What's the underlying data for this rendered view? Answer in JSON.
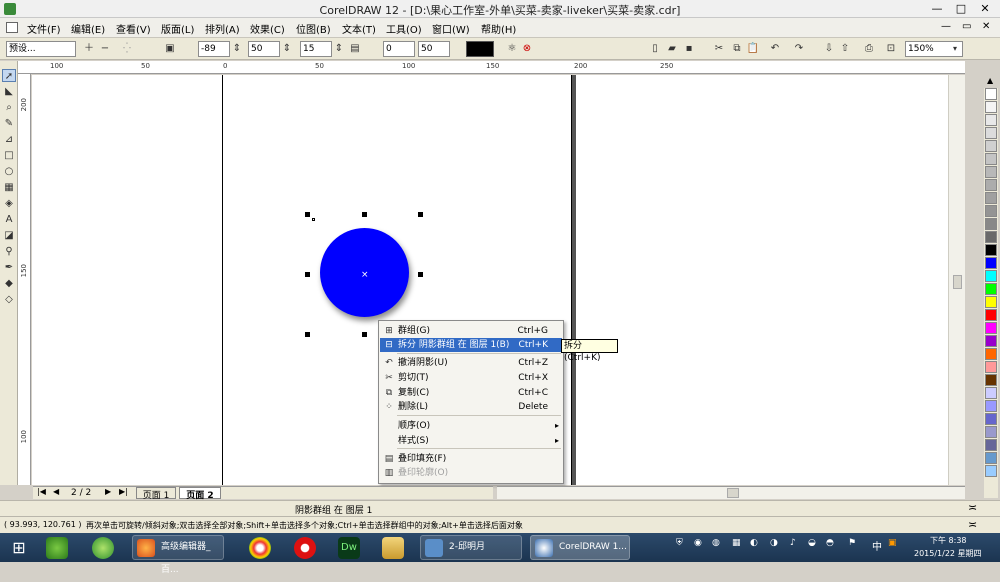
{
  "window": {
    "title": "CorelDRAW 12 - [D:\\果心工作室-外单\\买菜-卖家-liveker\\买菜-卖家.cdr]",
    "min": "—",
    "max": "□",
    "close": "✕"
  },
  "menus": [
    "文件(F)",
    "编辑(E)",
    "查看(V)",
    "版面(L)",
    "排列(A)",
    "效果(C)",
    "位图(B)",
    "文本(T)",
    "工具(O)",
    "窗口(W)",
    "帮助(H)"
  ],
  "propbar": {
    "preset": "预设...",
    "offset_x": "-89",
    "offset_y": "50",
    "feather": "15",
    "angle": "0",
    "opacity": "50",
    "zoom": "150%"
  },
  "ruler_h": [
    "100",
    "50",
    "0",
    "50",
    "100",
    "150",
    "200",
    "250"
  ],
  "ruler_v": [
    "200",
    "150",
    "100"
  ],
  "context_menu": {
    "items": [
      {
        "icon": "group-icon",
        "label": "群组(G)",
        "shortcut": "Ctrl+G",
        "highlighted": false,
        "disabled": false,
        "submenu": false
      },
      {
        "icon": "break-apart-icon",
        "label": "拆分 阴影群组 在 图层 1(B)",
        "shortcut": "Ctrl+K",
        "highlighted": true,
        "disabled": false,
        "submenu": false
      },
      {
        "icon": "undo-shadow-icon",
        "label": "撤消阴影(U)",
        "shortcut": "Ctrl+Z",
        "highlighted": false,
        "disabled": false,
        "submenu": false
      },
      {
        "icon": "cut-icon",
        "label": "剪切(T)",
        "shortcut": "Ctrl+X",
        "highlighted": false,
        "disabled": false,
        "submenu": false
      },
      {
        "icon": "copy-icon",
        "label": "复制(C)",
        "shortcut": "Ctrl+C",
        "highlighted": false,
        "disabled": false,
        "submenu": false
      },
      {
        "icon": "delete-icon",
        "label": "删除(L)",
        "shortcut": "Delete",
        "highlighted": false,
        "disabled": false,
        "submenu": false
      },
      {
        "icon": "",
        "label": "顺序(O)",
        "shortcut": "",
        "highlighted": false,
        "disabled": false,
        "submenu": true
      },
      {
        "icon": "",
        "label": "样式(S)",
        "shortcut": "",
        "highlighted": false,
        "disabled": false,
        "submenu": true
      },
      {
        "icon": "overprint-fill-icon",
        "label": "叠印填充(F)",
        "shortcut": "",
        "highlighted": false,
        "disabled": false,
        "submenu": false
      },
      {
        "icon": "overprint-outline-icon",
        "label": "叠印轮廓(O)",
        "shortcut": "",
        "highlighted": false,
        "disabled": true,
        "submenu": false
      }
    ],
    "tooltip": "拆分 (Ctrl+K)"
  },
  "page_nav": {
    "counter": "2 / 2",
    "tab1": "页面 1",
    "tab2": "页面 2"
  },
  "status": {
    "selection": "阴影群组 在 图层 1",
    "coords": "( 93.993, 120.761 )",
    "hint": "再次单击可旋转/倾斜对象;双击选择全部对象;Shift+单击选择多个对象;Ctrl+单击选择群组中的对象;Alt+单击选择后面对象"
  },
  "palette_colors": [
    "#ffffff",
    "#f4f4f4",
    "#e8e8e8",
    "#dcdcdc",
    "#d0d0d0",
    "#c4c4c4",
    "#b8b8b8",
    "#acacac",
    "#a0a0a0",
    "#949494",
    "#888888",
    "#6a6a6a",
    "#000000",
    "#0000ff",
    "#00ffff",
    "#00ff00",
    "#ffff00",
    "#ff0000",
    "#ff00ff",
    "#9900cc",
    "#ff6600",
    "#ff9999",
    "#663300",
    "#ccccff",
    "#9999ff",
    "#6666cc",
    "#9999cc",
    "#666699",
    "#6699cc",
    "#99ccff"
  ],
  "taskbar": {
    "tasks": [
      "高级编辑器_百...",
      "2-邱明月",
      "CorelDRAW 1..."
    ],
    "clock_time": "下午 8:38",
    "clock_date": "2015/1/22 星期四",
    "ime": "中"
  }
}
